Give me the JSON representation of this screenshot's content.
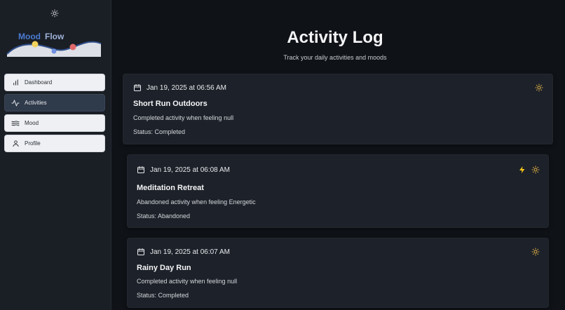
{
  "app": {
    "logo_text_1": "Mood",
    "logo_text_2": "Flow"
  },
  "sidebar": {
    "items": [
      {
        "label": "Dashboard",
        "icon": "bar-chart-icon"
      },
      {
        "label": "Activities",
        "icon": "activity-pulse-icon",
        "active": true
      },
      {
        "label": "Mood",
        "icon": "waves-icon"
      },
      {
        "label": "Profile",
        "icon": "user-icon"
      }
    ]
  },
  "header": {
    "title": "Activity Log",
    "subtitle": "Track your daily activities and moods"
  },
  "activities": [
    {
      "date": "Jan 19, 2025 at 06:56 AM",
      "title": "Short Run Outdoors",
      "description": "Completed activity when feeling null",
      "status": "Status: Completed",
      "icons": [
        "sun-icon"
      ]
    },
    {
      "date": "Jan 19, 2025 at 06:08 AM",
      "title": "Meditation Retreat",
      "description": "Abandoned activity when feeling Energetic",
      "status": "Status: Abandoned",
      "icons": [
        "lightning-icon",
        "sun-icon"
      ]
    },
    {
      "date": "Jan 19, 2025 at 06:07 AM",
      "title": "Rainy Day Run",
      "description": "Completed activity when feeling null",
      "status": "Status: Completed",
      "icons": [
        "sun-icon"
      ]
    }
  ],
  "colors": {
    "accent_sun": "#e9b949",
    "accent_lightning": "#f5c518",
    "logo_blue": "#4a7bd0",
    "dot_yellow": "#f2d35b",
    "dot_blue": "#6f8fe0",
    "dot_red": "#e06a6a"
  }
}
